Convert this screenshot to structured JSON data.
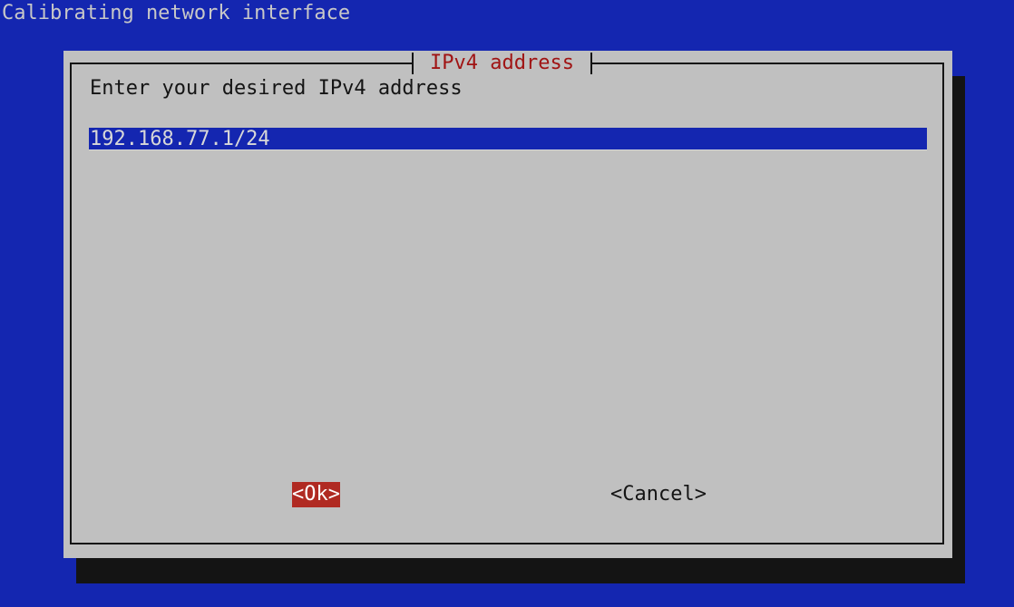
{
  "screen": {
    "backtitle": "Calibrating network interface"
  },
  "dialog": {
    "title": "IPv4 address",
    "prompt": "Enter your desired IPv4 address",
    "input_value": "192.168.77.1/24",
    "buttons": {
      "ok_label": "<Ok>",
      "cancel_label": "<Cancel>"
    }
  },
  "colors": {
    "background": "#1426b0",
    "dialog": "#c0c0c0",
    "title": "#a01414",
    "button_focus": "#b02a22",
    "shadow": "#141414"
  }
}
